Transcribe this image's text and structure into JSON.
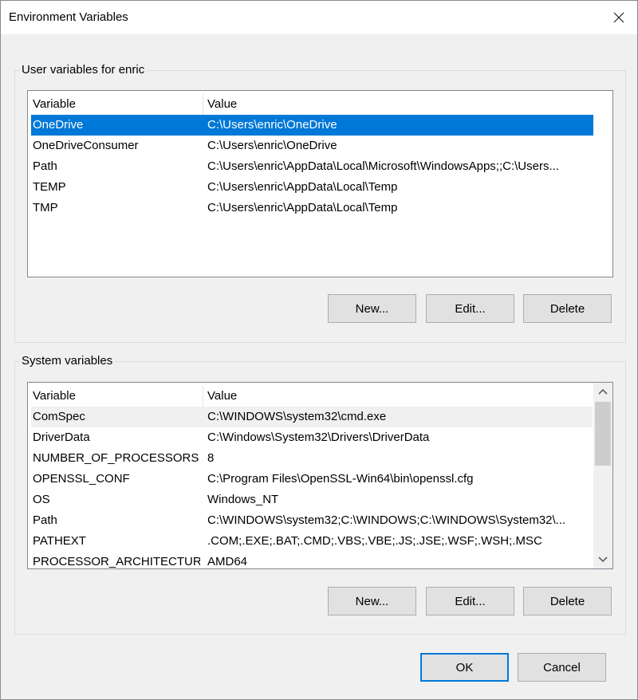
{
  "window": {
    "title": "Environment Variables"
  },
  "user_section": {
    "label": "User variables for enric",
    "columns": [
      "Variable",
      "Value"
    ],
    "rows": [
      {
        "variable": "OneDrive",
        "value": "C:\\Users\\enric\\OneDrive",
        "selected": true
      },
      {
        "variable": "OneDriveConsumer",
        "value": "C:\\Users\\enric\\OneDrive"
      },
      {
        "variable": "Path",
        "value": "C:\\Users\\enric\\AppData\\Local\\Microsoft\\WindowsApps;;C:\\Users..."
      },
      {
        "variable": "TEMP",
        "value": "C:\\Users\\enric\\AppData\\Local\\Temp"
      },
      {
        "variable": "TMP",
        "value": "C:\\Users\\enric\\AppData\\Local\\Temp"
      }
    ],
    "buttons": {
      "new": "New...",
      "edit": "Edit...",
      "delete": "Delete"
    }
  },
  "system_section": {
    "label": "System variables",
    "columns": [
      "Variable",
      "Value"
    ],
    "rows": [
      {
        "variable": "ComSpec",
        "value": "C:\\WINDOWS\\system32\\cmd.exe",
        "highlighted": true
      },
      {
        "variable": "DriverData",
        "value": "C:\\Windows\\System32\\Drivers\\DriverData"
      },
      {
        "variable": "NUMBER_OF_PROCESSORS",
        "value": "8"
      },
      {
        "variable": "OPENSSL_CONF",
        "value": "C:\\Program Files\\OpenSSL-Win64\\bin\\openssl.cfg"
      },
      {
        "variable": "OS",
        "value": "Windows_NT"
      },
      {
        "variable": "Path",
        "value": "C:\\WINDOWS\\system32;C:\\WINDOWS;C:\\WINDOWS\\System32\\..."
      },
      {
        "variable": "PATHEXT",
        "value": ".COM;.EXE;.BAT;.CMD;.VBS;.VBE;.JS;.JSE;.WSF;.WSH;.MSC"
      },
      {
        "variable": "PROCESSOR_ARCHITECTURE",
        "value": "AMD64"
      }
    ],
    "buttons": {
      "new": "New...",
      "edit": "Edit...",
      "delete": "Delete"
    }
  },
  "footer": {
    "ok": "OK",
    "cancel": "Cancel"
  },
  "colors": {
    "selection": "#0078d7",
    "default_button_border": "#0078d7"
  }
}
